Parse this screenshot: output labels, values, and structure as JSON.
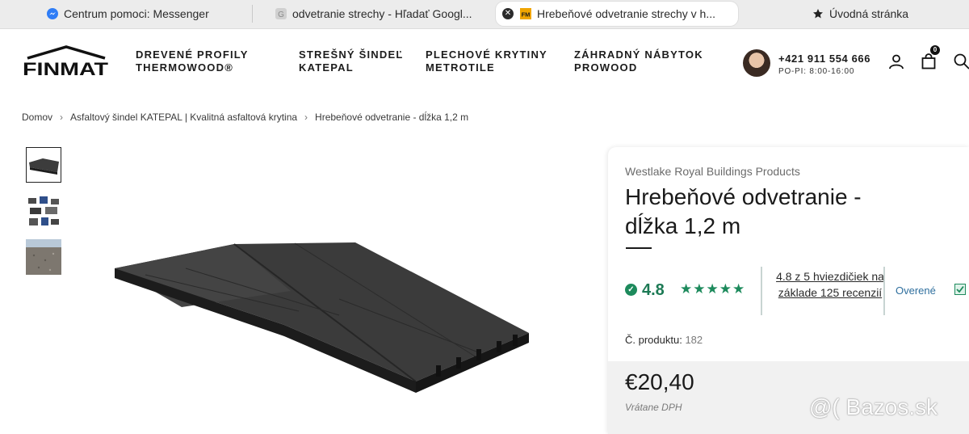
{
  "browser": {
    "tabs": [
      {
        "title": "Centrum pomoci: Messenger",
        "icon": "messenger-icon"
      },
      {
        "title": "odvetranie strechy - Hľadať Googl...",
        "icon": "google-icon"
      },
      {
        "title": "Hrebeňové odvetranie strechy v h...",
        "icon": "finmat-icon",
        "active": true
      },
      {
        "title": "Úvodná stránka",
        "icon": "star-icon"
      }
    ]
  },
  "header": {
    "logo_text": "FINMAT",
    "nav": [
      {
        "line1": "DREVENÉ PROFILY",
        "line2": "THERMOWOOD®"
      },
      {
        "line1": "STREŠNÝ ŠINDEĽ",
        "line2": "KATEPAL"
      },
      {
        "line1": "PLECHOVÉ KRYTINY",
        "line2": "METROTILE"
      },
      {
        "line1": "ZÁHRADNÝ NÁBYTOK",
        "line2": "PROWOOD"
      }
    ],
    "phone": "+421 911 554 666",
    "hours": "PO-PI: 8:00-16:00",
    "cart_count": "0"
  },
  "breadcrumb": [
    "Domov",
    "Asfaltový šindel KATEPAL | Kvalitná asfaltová krytina",
    "Hrebeňové odvetranie - dĺžka 1,2 m"
  ],
  "product": {
    "brand": "Westlake Royal Buildings Products",
    "title": "Hrebeňové odvetranie - dĺžka 1,2 m",
    "rating": "4.8",
    "stars": "★★★★★",
    "reviews_text": "4.8 z 5 hviezdičiek na základe 125 recenzií",
    "verified_label": "Overené",
    "sku_label": "Č. produktu:",
    "sku_value": "182",
    "price": "€20,40",
    "vat_note": "Vrátane DPH"
  },
  "watermark": "@( Bazos.sk",
  "colors": {
    "accent_green": "#1d8a5c",
    "price_bg": "#f1f1f1",
    "verified_blue": "#2f6f9e"
  }
}
